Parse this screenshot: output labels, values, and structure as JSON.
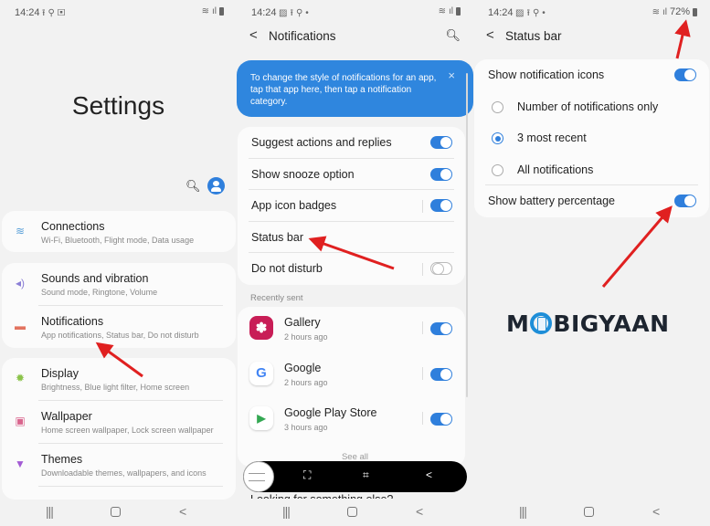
{
  "screens": {
    "settings": {
      "status": {
        "time": "14:24",
        "left_icons": [
          "upload-icon",
          "wrench-icon",
          "screenshot-icon"
        ],
        "right_icons": [
          "wifi-icon",
          "signal-icon",
          "battery-icon"
        ]
      },
      "title": "Settings",
      "header_icons": [
        "search-icon",
        "account-icon"
      ],
      "groups": [
        [
          {
            "icon": "wifi-icon",
            "glyph": "≋",
            "color": "#5aa0d8",
            "label": "Connections",
            "sub": "Wi-Fi, Bluetooth, Flight mode, Data usage"
          }
        ],
        [
          {
            "icon": "volume-icon",
            "glyph": "◂)",
            "color": "#8b7fd6",
            "label": "Sounds and vibration",
            "sub": "Sound mode, Ringtone, Volume"
          },
          {
            "icon": "notification-icon",
            "glyph": "▬",
            "color": "#e2735f",
            "label": "Notifications",
            "sub": "App notifications, Status bar, Do not disturb"
          }
        ],
        [
          {
            "icon": "brightness-icon",
            "glyph": "✹",
            "color": "#8bc34a",
            "label": "Display",
            "sub": "Brightness, Blue light filter, Home screen"
          },
          {
            "icon": "wallpaper-icon",
            "glyph": "▣",
            "color": "#d9658d",
            "label": "Wallpaper",
            "sub": "Home screen wallpaper, Lock screen wallpaper"
          },
          {
            "icon": "themes-icon",
            "glyph": "▼",
            "color": "#a35bd4",
            "label": "Themes",
            "sub": "Downloadable themes, wallpapers, and icons"
          }
        ]
      ]
    },
    "notifications": {
      "status": {
        "time": "14:24",
        "left_icons": [
          "image-icon",
          "upload-icon",
          "wrench-icon",
          "dot-icon"
        ],
        "right_icons": [
          "wifi-icon",
          "signal-icon",
          "battery-icon"
        ]
      },
      "title": "Notifications",
      "back_glyph": "<",
      "tip": "To change the style of notifications for an app, tap that app here, then tap a notification category.",
      "tip_close": "×",
      "settings": [
        {
          "label": "Suggest actions and replies",
          "toggle": true,
          "separator": false
        },
        {
          "label": "Show snooze option",
          "toggle": true,
          "separator": false
        },
        {
          "label": "App icon badges",
          "toggle": true,
          "separator": true
        },
        {
          "label": "Status bar",
          "toggle": null,
          "separator": false
        },
        {
          "label": "Do not disturb",
          "toggle": false,
          "separator": true
        }
      ],
      "recent_label": "Recently sent",
      "apps": [
        {
          "name": "Gallery",
          "time": "2 hours ago",
          "enabled": true,
          "icon": "gallery-icon",
          "glyph": "✽",
          "bg": "#c81d56",
          "fg": "#ffffff"
        },
        {
          "name": "Google",
          "time": "2 hours ago",
          "enabled": true,
          "icon": "google-icon",
          "glyph": "G",
          "bg": "#ffffff",
          "fg": "#4285f4"
        },
        {
          "name": "Google Play Store",
          "time": "3 hours ago",
          "enabled": true,
          "icon": "play-store-icon",
          "glyph": "▶",
          "bg": "#ffffff",
          "fg": "#34a853"
        }
      ],
      "see_all": "See all",
      "screenshot_toolbar": [
        "screenshot-thumbnail",
        "scroll-capture-icon",
        "crop-edit-icon",
        "share-icon"
      ],
      "looking_text": "Looking for something else?"
    },
    "status_bar": {
      "status": {
        "time": "14:24",
        "left_icons": [
          "image-icon",
          "upload-icon",
          "wrench-icon",
          "dot-icon"
        ],
        "battery_percent": "72%"
      },
      "title": "Status bar",
      "back_glyph": "<",
      "show_notification_icons": {
        "label": "Show notification icons",
        "enabled": true
      },
      "options": [
        {
          "label": "Number of notifications only",
          "selected": false
        },
        {
          "label": "3 most recent",
          "selected": true
        },
        {
          "label": "All notifications",
          "selected": false
        }
      ],
      "show_battery_percentage": {
        "label": "Show battery percentage",
        "enabled": true
      }
    }
  },
  "watermark": {
    "pre": "M",
    "post": "BIGYAAN",
    "colors": {
      "text": "#1d2530",
      "accent": "#1e8ed8"
    }
  },
  "navbar": {
    "recents": "|||",
    "back": "<"
  },
  "colors": {
    "accent": "#2f7fdc",
    "tip_bg": "#2f86de",
    "arrow": "#e02020",
    "bg": "#f2f2f2",
    "card": "#fbfbfb"
  }
}
